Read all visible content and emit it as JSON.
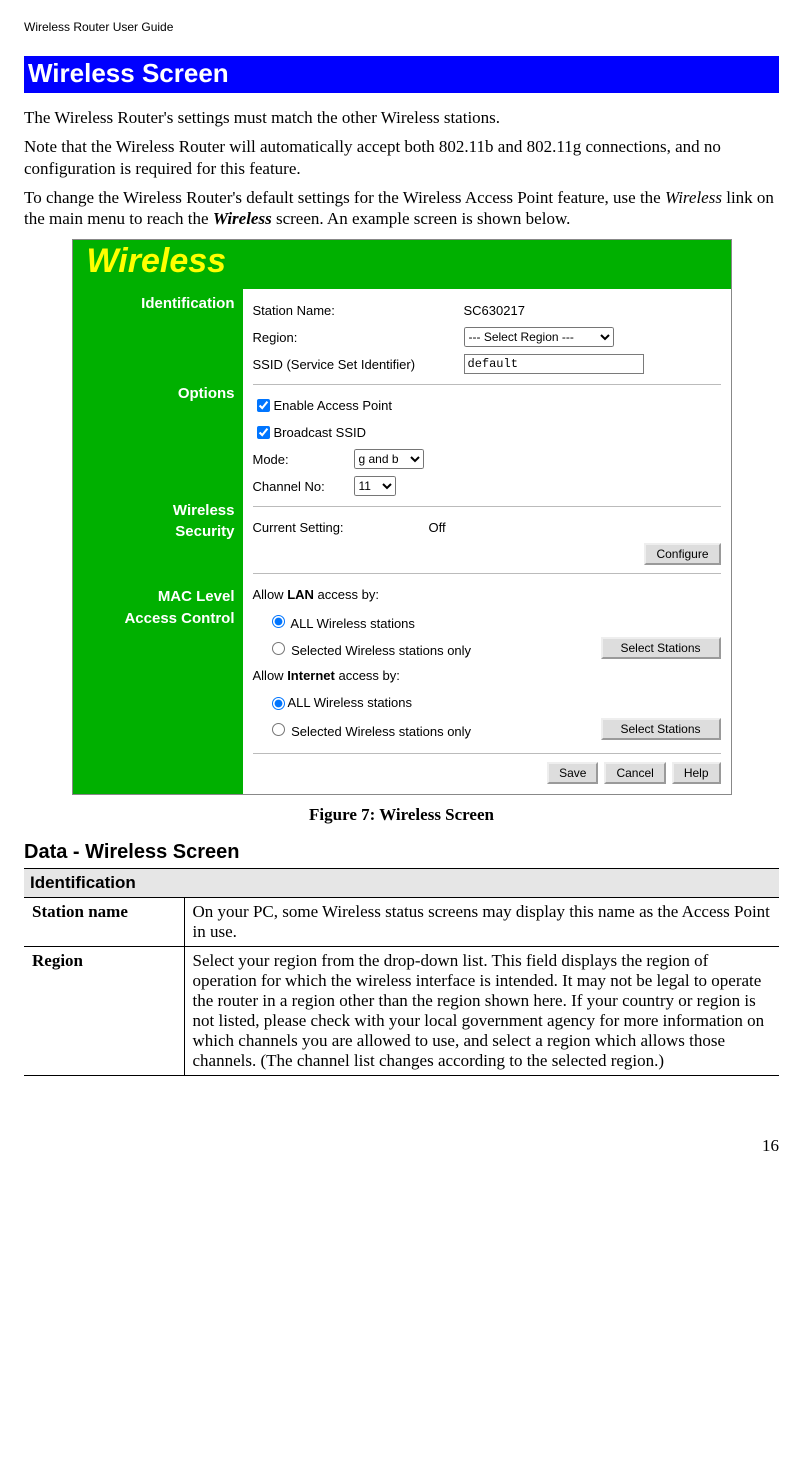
{
  "header": {
    "guide_title": "Wireless Router User Guide"
  },
  "section": {
    "heading": "Wireless Screen",
    "para1": "The Wireless Router's settings must match the other Wireless stations.",
    "para2": "Note that the Wireless Router will automatically accept both 802.11b and 802.11g connections, and no configuration is required for this feature.",
    "para3a": "To change the Wireless Router's default settings for the Wireless Access Point feature, use the ",
    "para3_em1": "Wireless",
    "para3b": " link on the main menu to reach the ",
    "para3_em2": "Wireless",
    "para3c": " screen. An example screen is shown below."
  },
  "figure": {
    "title": "Wireless",
    "sidebar": {
      "s1": "Identification",
      "s2": "Options",
      "s3a": "Wireless",
      "s3b": "Security",
      "s4a": "MAC Level",
      "s4b": "Access Control"
    },
    "identification": {
      "station_name_label": "Station Name:",
      "station_name_value": "SC630217",
      "region_label": "Region:",
      "region_value": "--- Select Region ---",
      "ssid_label": "SSID (Service Set Identifier)",
      "ssid_value": "default"
    },
    "options": {
      "enable_ap": "Enable Access Point",
      "broadcast_ssid": "Broadcast SSID",
      "mode_label": "Mode:",
      "mode_value": "g and b",
      "channel_label": "Channel No:",
      "channel_value": "11"
    },
    "security": {
      "current_setting_label": "Current Setting:",
      "current_setting_value": "Off",
      "configure_btn": "Configure"
    },
    "mac": {
      "lan_label_a": "Allow ",
      "lan_label_b": "LAN",
      "lan_label_c": " access by:",
      "opt_all": "ALL Wireless stations",
      "opt_selected": "Selected Wireless stations only",
      "select_stations_btn": "Select Stations",
      "internet_label_a": "Allow ",
      "internet_label_b": "Internet",
      "internet_label_c": " access by:"
    },
    "footer": {
      "save": "Save",
      "cancel": "Cancel",
      "help": "Help"
    },
    "caption": "Figure 7: Wireless Screen"
  },
  "data_table": {
    "heading": "Data - Wireless Screen",
    "group1": "Identification",
    "row1_key": "Station name",
    "row1_val": "On your PC, some Wireless status screens may display this name as the Access Point in use.",
    "row2_key": "Region",
    "row2_val": "Select your region from the drop-down list. This field displays the region of operation for which the wireless interface is intended. It may not be legal to operate the router in a region other than the region shown here. If your country or region is not listed, please check with your local government agency for more information on which channels you are allowed to use, and select a region which allows those channels. (The channel list changes according to the selected region.)"
  },
  "page_number": "16"
}
